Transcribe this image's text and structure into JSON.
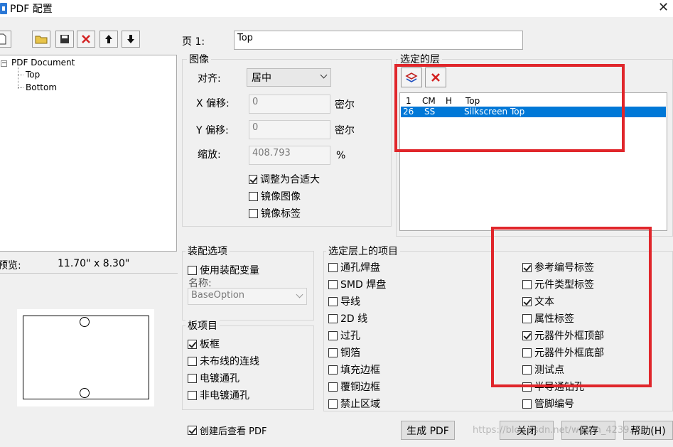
{
  "window": {
    "title": "PDF 配置",
    "close": "✕"
  },
  "page_field": {
    "label": "页 1:",
    "value": "Top"
  },
  "tree": {
    "root": "PDF Document",
    "children": [
      "Top",
      "Bottom"
    ]
  },
  "preview": {
    "label": "预览:",
    "size": "11.70\" x  8.30\""
  },
  "image_group": {
    "title": "图像",
    "align_label": "对齐:",
    "align_value": "居中",
    "x_offset_label": "X 偏移:",
    "x_offset_value": "0",
    "x_unit": "密尔",
    "y_offset_label": "Y 偏移:",
    "y_offset_value": "0",
    "y_unit": "密尔",
    "scale_label": "缩放:",
    "scale_value": "408.793",
    "scale_unit": "%",
    "fit_label": "调整为合适大",
    "mirror_image_label": "镜像图像",
    "mirror_label_label": "镜像标签"
  },
  "selected_layers": {
    "title": "选定的层",
    "header": [
      "1",
      "CM",
      "H",
      "Top"
    ],
    "rows": [
      {
        "num": "26",
        "code": "SS",
        "h": "",
        "name": "Silkscreen Top"
      }
    ]
  },
  "assembly": {
    "title": "装配选项",
    "use_variant_label": "使用装配变量",
    "name_label": "名称:",
    "name_value": "BaseOption"
  },
  "board_items": {
    "title": "板项目",
    "items": [
      {
        "label": "板框",
        "checked": true
      },
      {
        "label": "未布线的连线",
        "checked": false
      },
      {
        "label": "电镀通孔",
        "checked": false
      },
      {
        "label": "非电镀通孔",
        "checked": false
      }
    ]
  },
  "layer_items": {
    "title": "选定层上的项目",
    "left": [
      {
        "label": "通孔焊盘",
        "checked": false
      },
      {
        "label": "SMD 焊盘",
        "checked": false
      },
      {
        "label": "导线",
        "checked": false
      },
      {
        "label": "2D 线",
        "checked": false
      },
      {
        "label": "过孔",
        "checked": false
      },
      {
        "label": "铜箔",
        "checked": false
      },
      {
        "label": "填充边框",
        "checked": false
      },
      {
        "label": "覆铜边框",
        "checked": false
      },
      {
        "label": "禁止区域",
        "checked": false
      }
    ],
    "right": [
      {
        "label": "参考编号标签",
        "checked": true
      },
      {
        "label": "元件类型标签",
        "checked": false
      },
      {
        "label": "文本",
        "checked": true
      },
      {
        "label": "属性标签",
        "checked": false
      },
      {
        "label": "元器件外框顶部",
        "checked": true
      },
      {
        "label": "元器件外框底部",
        "checked": false
      },
      {
        "label": "测试点",
        "checked": false
      },
      {
        "label": "半导通钻孔",
        "checked": false
      },
      {
        "label": "管脚编号",
        "checked": false
      }
    ]
  },
  "view_after": {
    "label": "创建后查看 PDF",
    "checked": true
  },
  "buttons": {
    "generate": "生成 PDF",
    "close": "关闭",
    "save": "保存",
    "help": "帮助(H)"
  },
  "watermark": "https://blog.csdn.net/weixin_4239..."
}
